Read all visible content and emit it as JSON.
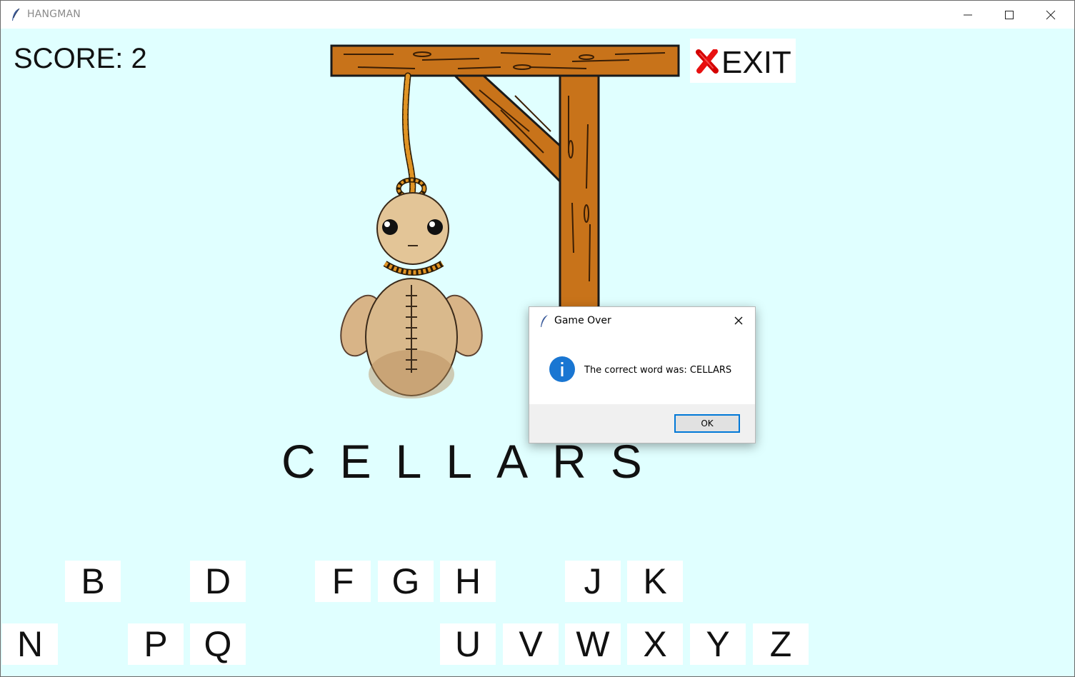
{
  "window": {
    "title": "HANGMAN"
  },
  "score": {
    "label": "SCORE: 2"
  },
  "exit": {
    "label": "EXIT"
  },
  "word": {
    "text": "CELLARS"
  },
  "keys_row1": [
    {
      "letter": "B",
      "name": "key-b"
    },
    {
      "letter": "D",
      "name": "key-d"
    },
    {
      "letter": "F",
      "name": "key-f"
    },
    {
      "letter": "G",
      "name": "key-g"
    },
    {
      "letter": "H",
      "name": "key-h"
    },
    {
      "letter": "J",
      "name": "key-j"
    },
    {
      "letter": "K",
      "name": "key-k"
    }
  ],
  "keys_row2": [
    {
      "letter": "N",
      "name": "key-n"
    },
    {
      "letter": "P",
      "name": "key-p"
    },
    {
      "letter": "Q",
      "name": "key-q"
    },
    {
      "letter": "U",
      "name": "key-u"
    },
    {
      "letter": "V",
      "name": "key-v"
    },
    {
      "letter": "W",
      "name": "key-w"
    },
    {
      "letter": "X",
      "name": "key-x"
    },
    {
      "letter": "Y",
      "name": "key-y"
    },
    {
      "letter": "Z",
      "name": "key-z"
    }
  ],
  "dialog": {
    "title": "Game Over",
    "message": "The correct word was: CELLARS",
    "ok_label": "OK"
  },
  "colors": {
    "background": "#e0ffff",
    "wood": "#c8731a",
    "rope": "#d98a1c",
    "accent": "#0078d7"
  },
  "icons": {
    "app": "feather-icon",
    "exit": "red-x-icon",
    "dialog_info": "info-icon"
  }
}
